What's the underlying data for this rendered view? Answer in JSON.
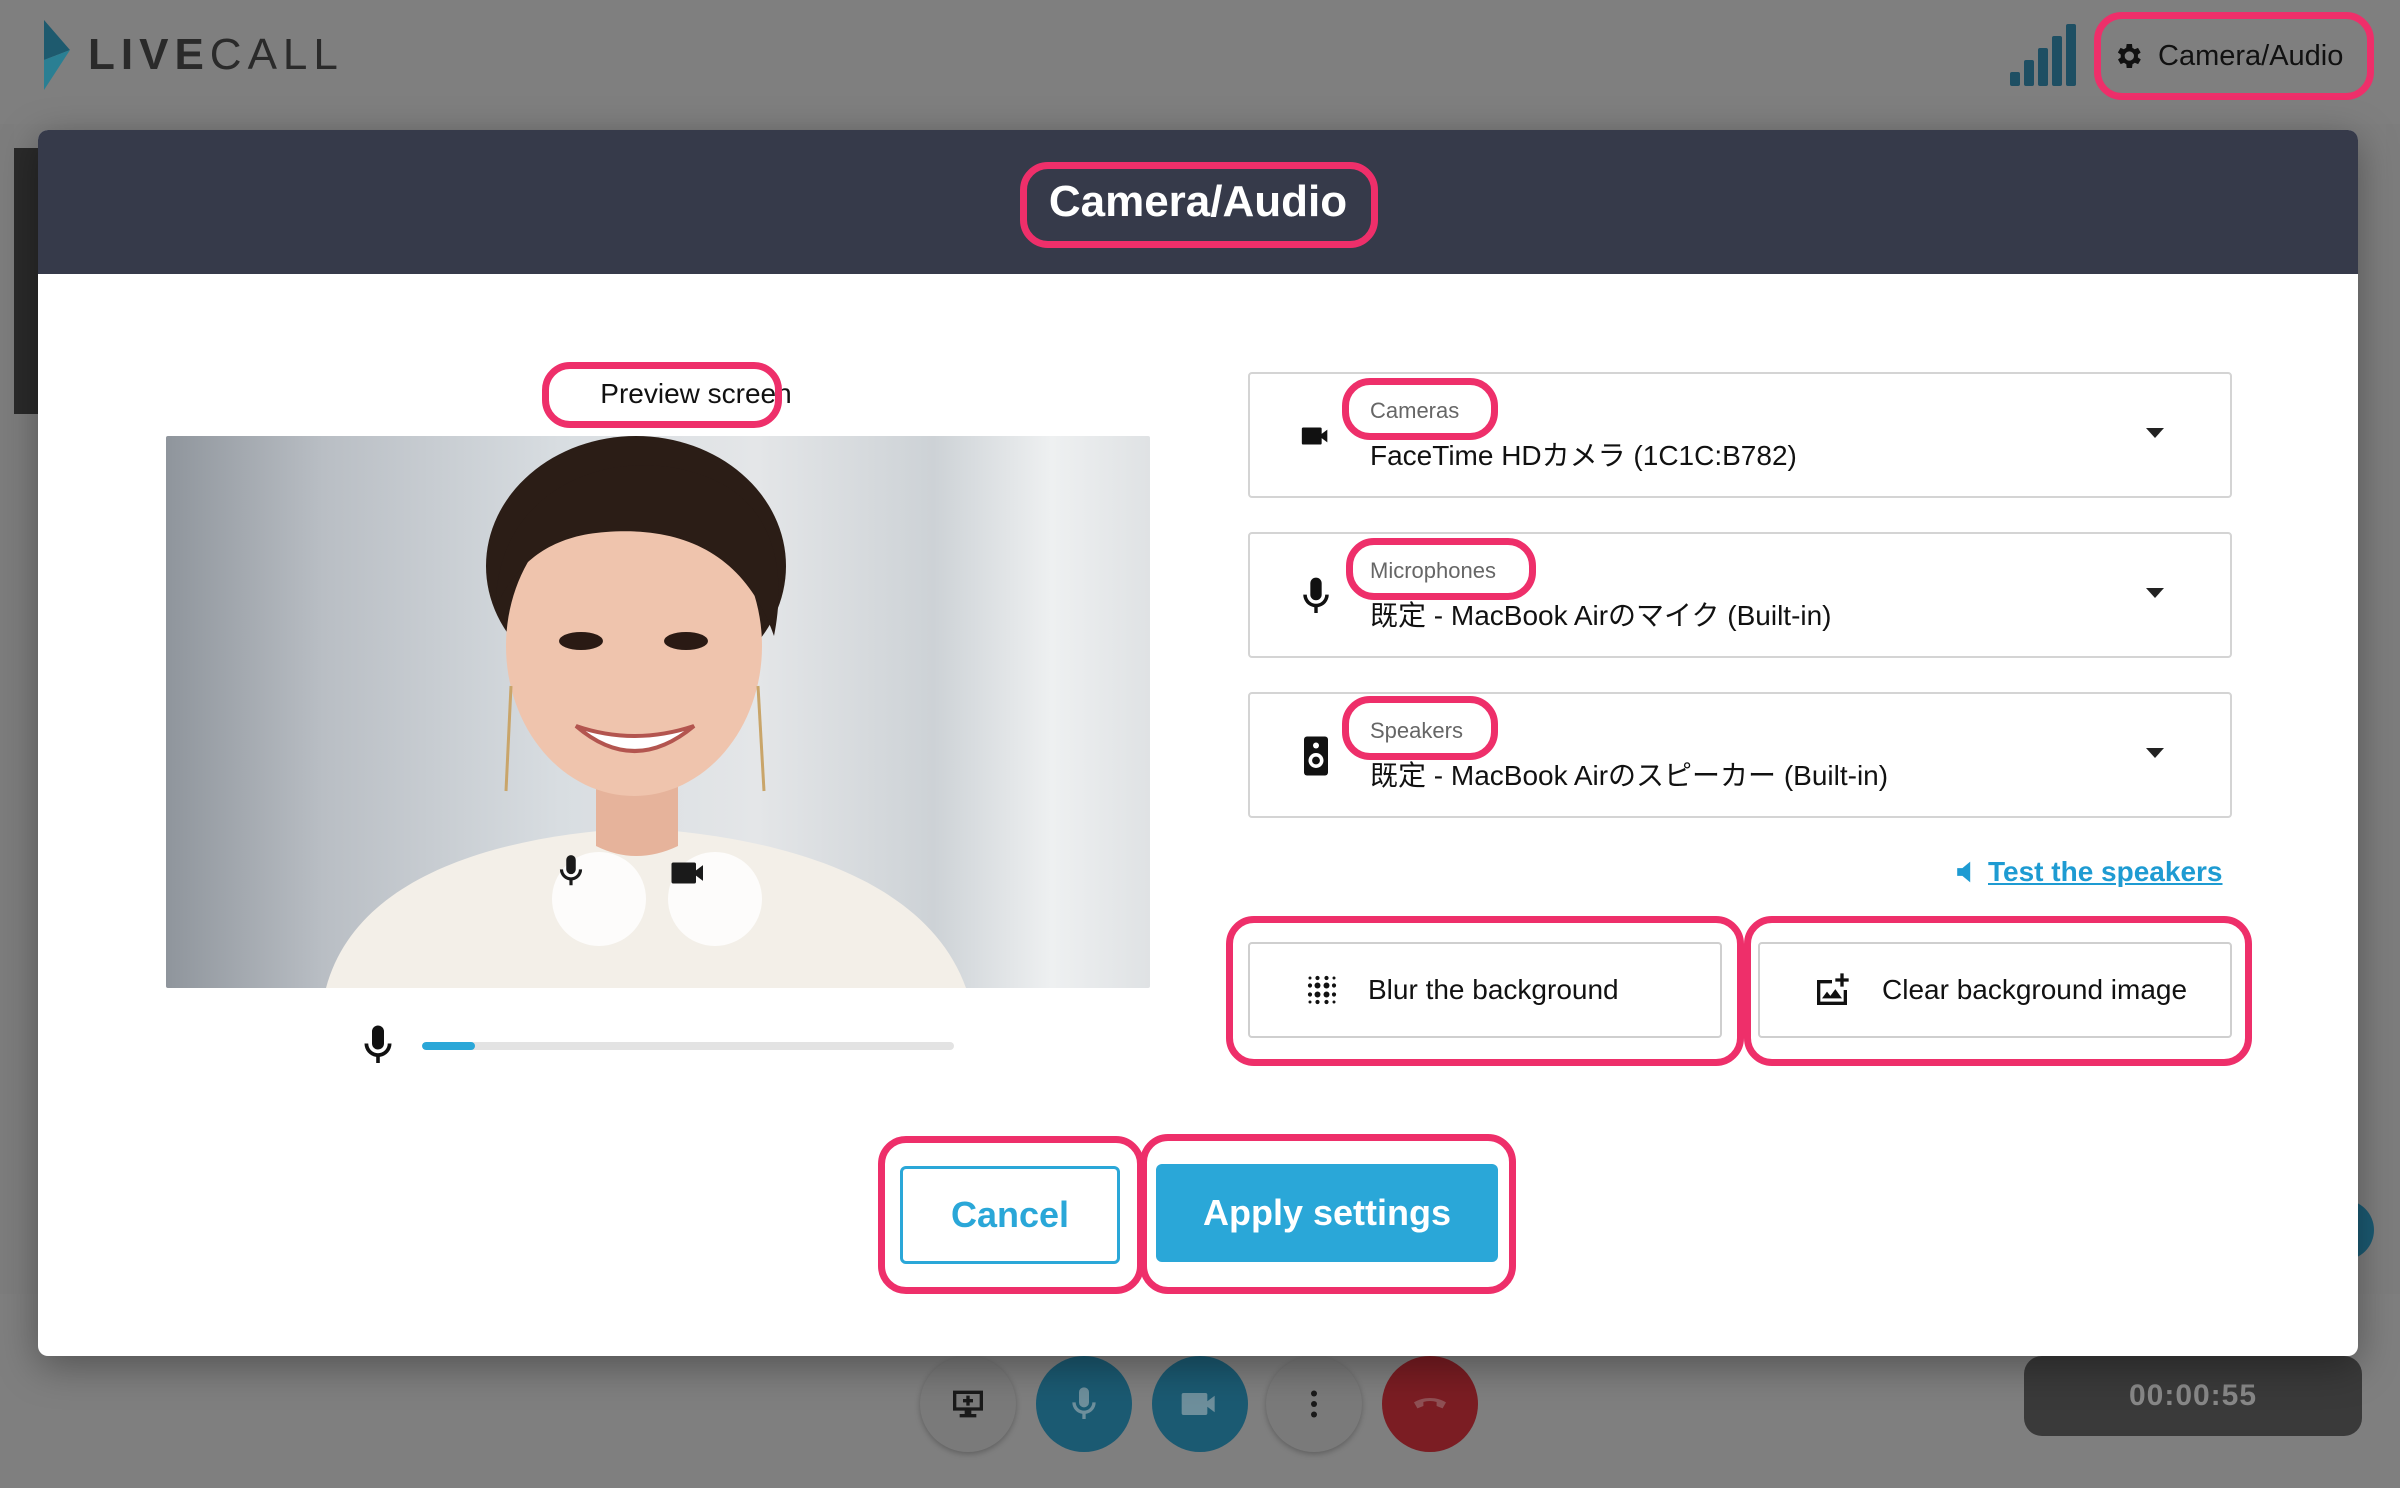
{
  "app": {
    "logo_bold": "LIVE",
    "logo_light": "CALL",
    "signal_icon": "signal-bars-icon",
    "header_button_label": "Camera/Audio",
    "header_button_icon": "gear-icon",
    "timer": "00:00:55"
  },
  "toolbar": {
    "screen_share_icon": "screen-share-icon",
    "mic_icon": "microphone-icon",
    "camera_icon": "video-camera-icon",
    "more_icon": "more-vertical-icon",
    "hangup_icon": "phone-hangup-icon"
  },
  "modal": {
    "title": "Camera/Audio",
    "preview_label": "Preview screen",
    "mic_level": 0.1,
    "devices": [
      {
        "label": "Cameras",
        "value": "FaceTime HDカメラ (1C1C:B782)",
        "icon": "video-camera-icon"
      },
      {
        "label": "Microphones",
        "value": "既定 - MacBook Airのマイク (Built-in)",
        "icon": "microphone-icon"
      },
      {
        "label": "Speakers",
        "value": "既定 - MacBook Airのスピーカー (Built-in)",
        "icon": "speaker-icon"
      }
    ],
    "test_speakers_label": "Test the speakers",
    "blur_label": "Blur the background",
    "clear_bg_label": "Clear background image",
    "cancel_label": "Cancel",
    "apply_label": "Apply settings"
  },
  "colors": {
    "accent": "#2aa7d8",
    "highlight": "#ee2f6a",
    "modal_header": "#363a4a",
    "hangup": "#c0303a"
  }
}
